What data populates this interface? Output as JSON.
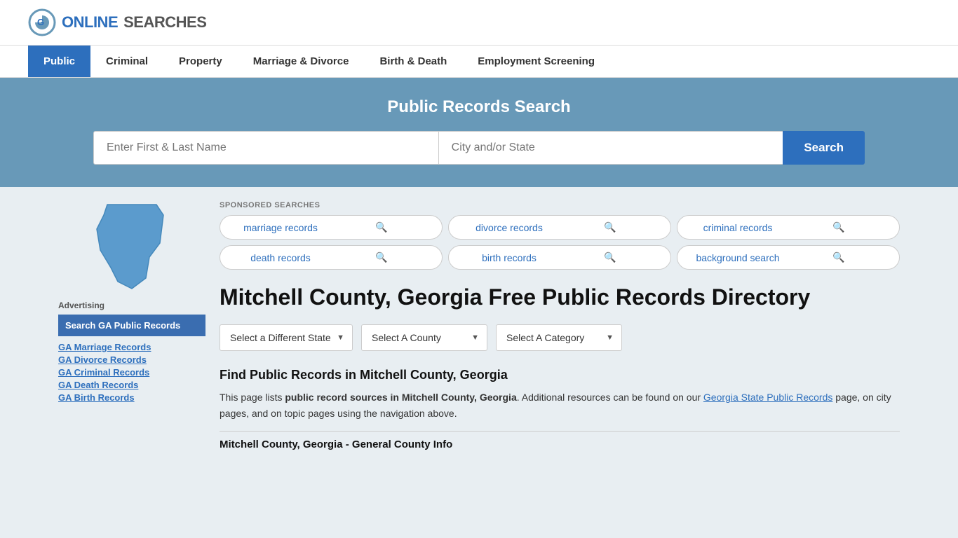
{
  "logo": {
    "text_online": "ONLINE",
    "text_searches": "SEARCHES",
    "icon_label": "G logo"
  },
  "nav": {
    "items": [
      {
        "label": "Public",
        "active": true
      },
      {
        "label": "Criminal",
        "active": false
      },
      {
        "label": "Property",
        "active": false
      },
      {
        "label": "Marriage & Divorce",
        "active": false
      },
      {
        "label": "Birth & Death",
        "active": false
      },
      {
        "label": "Employment Screening",
        "active": false
      }
    ]
  },
  "hero": {
    "title": "Public Records Search",
    "name_placeholder": "Enter First & Last Name",
    "city_placeholder": "City and/or State",
    "search_button": "Search"
  },
  "sponsored": {
    "label": "SPONSORED SEARCHES",
    "items": [
      "marriage records",
      "divorce records",
      "criminal records",
      "death records",
      "birth records",
      "background search"
    ]
  },
  "page": {
    "title": "Mitchell County, Georgia Free Public Records Directory",
    "dropdowns": {
      "state": "Select a Different State",
      "county": "Select A County",
      "category": "Select A Category"
    },
    "find_title": "Find Public Records in Mitchell County, Georgia",
    "find_desc_1": "This page lists ",
    "find_desc_bold": "public record sources in Mitchell County, Georgia",
    "find_desc_2": ". Additional resources can be found on our ",
    "find_link": "Georgia State Public Records",
    "find_desc_3": " page, on city pages, and on topic pages using the navigation above.",
    "general_info": "Mitchell County, Georgia - General County Info"
  },
  "sidebar": {
    "ad_label": "Advertising",
    "ad_box": "Search GA Public Records",
    "links": [
      "GA Marriage Records",
      "GA Divorce Records",
      "GA Criminal Records",
      "GA Death Records",
      "GA Birth Records"
    ]
  }
}
